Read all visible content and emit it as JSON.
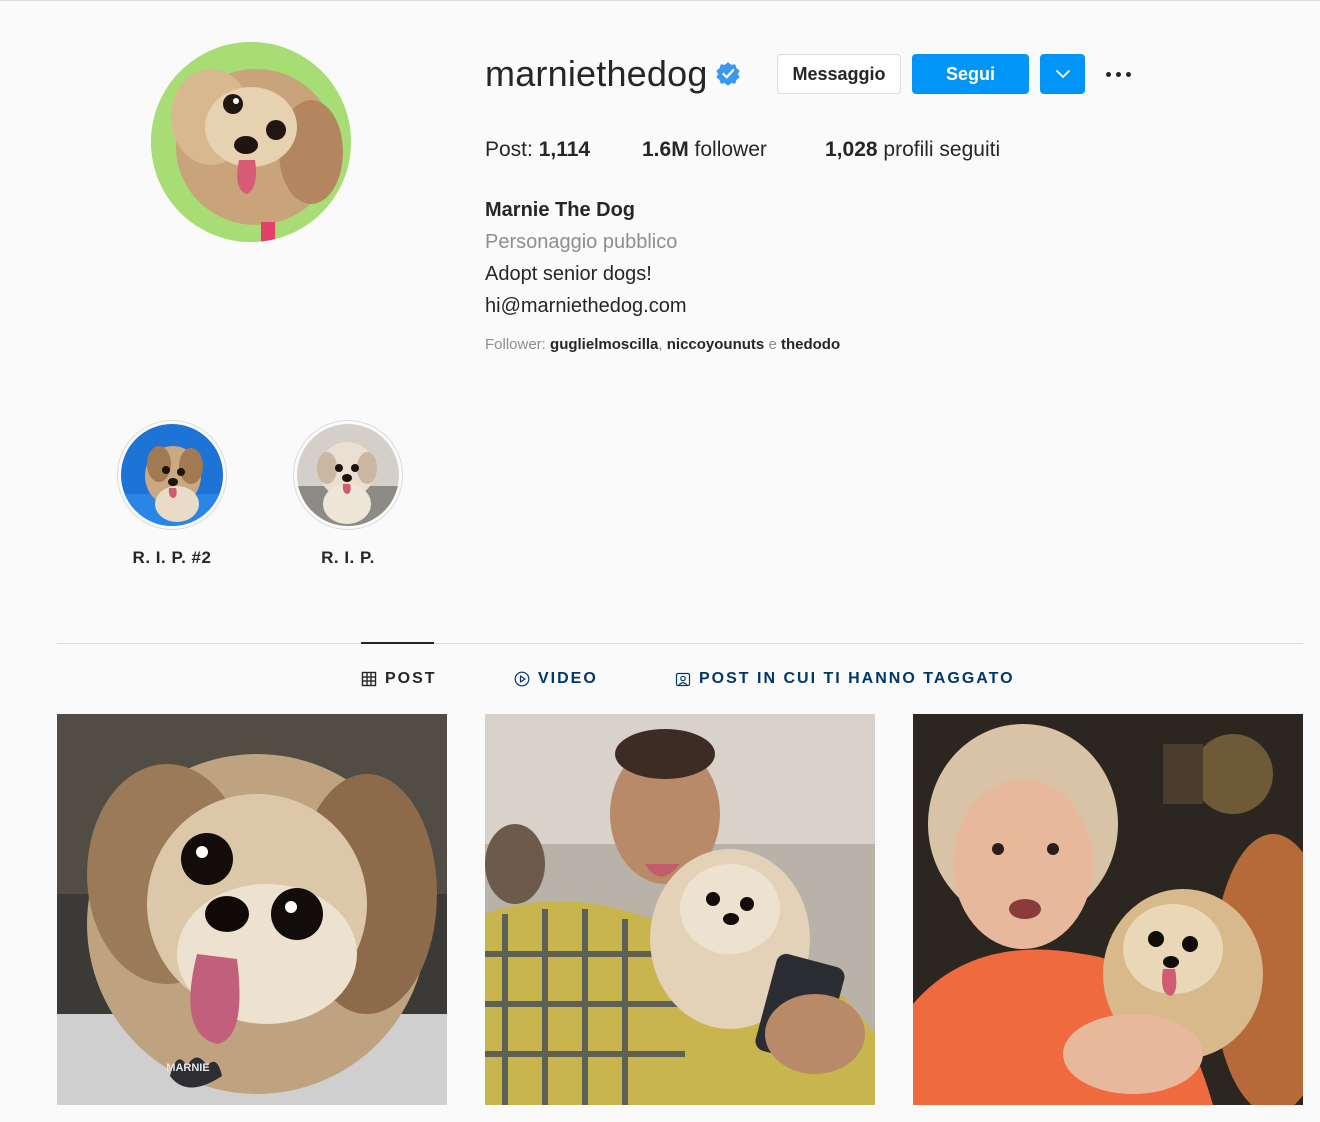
{
  "profile": {
    "username": "marniethedog",
    "verified_icon": "verified-badge-icon",
    "message_label": "Messaggio",
    "follow_label": "Segui",
    "stats": {
      "posts_label": "Post:",
      "posts_value": "1,114",
      "followers_value": "1.6M",
      "followers_label": "follower",
      "following_value": "1,028",
      "following_label": "profili seguiti"
    },
    "bio": {
      "name": "Marnie The Dog",
      "category": "Personaggio pubblico",
      "line1": "Adopt senior dogs!",
      "line2": "hi@marniethedog.com"
    },
    "followed_by": {
      "prefix": "Follower:",
      "user1": "guglielmoscilla",
      "sep": ",",
      "user2": "niccoyounuts",
      "and": "e",
      "user3": "thedodo"
    }
  },
  "highlights": [
    {
      "label": "R. I. P. #2"
    },
    {
      "label": "R. I. P."
    }
  ],
  "tabs": [
    {
      "label": "POST",
      "icon": "grid-icon",
      "active": true
    },
    {
      "label": "VIDEO",
      "icon": "play-icon",
      "active": false
    },
    {
      "label": "POST IN CUI TI HANNO TAGGATO",
      "icon": "tagged-icon",
      "active": false
    }
  ],
  "posts": [
    {
      "tag_text": "MARNIE"
    },
    {
      "tag_text": ""
    },
    {
      "tag_text": ""
    }
  ],
  "colors": {
    "accent": "#0095f6",
    "text": "#262626",
    "secondary": "#8e8e8e",
    "link": "#00376b",
    "background": "#fafafa"
  }
}
